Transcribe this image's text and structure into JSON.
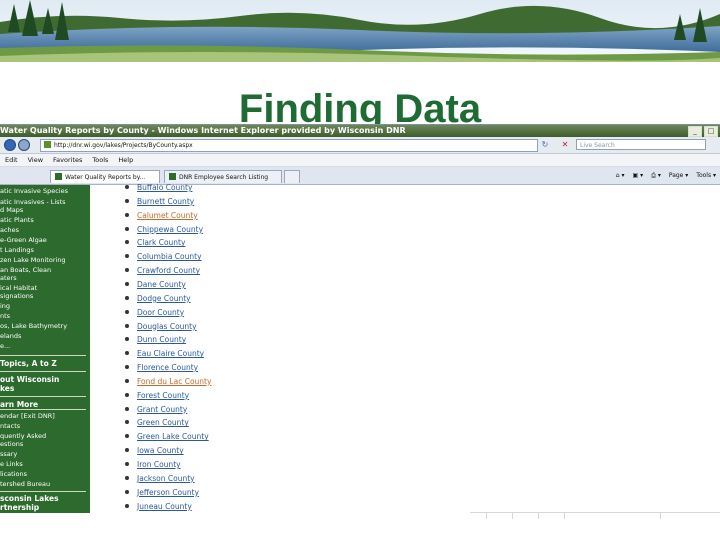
{
  "slide": {
    "title": "Finding Data"
  },
  "browser": {
    "window_title": "Water Quality Reports by County - Windows Internet Explorer provided by Wisconsin DNR",
    "address": "http://dnr.wi.gov/lakes/Projects/ByCounty.aspx",
    "search_placeholder": "Live Search",
    "menu": [
      "Edit",
      "View",
      "Favorites",
      "Tools",
      "Help"
    ],
    "tabs": [
      {
        "label": "Water Quality Reports by..."
      },
      {
        "label": "DNR Employee Search Listing"
      }
    ],
    "tools": {
      "page_label": "Page",
      "tools_label": "Tools"
    },
    "winbtns": {
      "minimize": "_",
      "maximize": "□"
    }
  },
  "sidebar": {
    "items": [
      "atic Invasive Species",
      "atic Invasives - Lists",
      "d Maps",
      "atic Plants",
      "aches",
      "e-Green Algae",
      "t Landings",
      "zen Lake Monitoring",
      "an Boats, Clean",
      "aters",
      "ical Habitat",
      "signations",
      "ing",
      "nts",
      "os, Lake Bathymetry",
      "elands",
      "e..."
    ],
    "head_topics": "Topics, A to Z",
    "head_about_1": "out Wisconsin",
    "head_about_2": "kes",
    "head_learn": "arn More",
    "learn_items": [
      "endar [Exit DNR]",
      "ntacts",
      "quently Asked",
      "estions",
      "ssary",
      "e Links",
      "lications",
      "tershed Bureau"
    ],
    "head_partner_1": "sconsin Lakes",
    "head_partner_2": "rtnership"
  },
  "counties": [
    {
      "name": "Buffalo County",
      "visited": false
    },
    {
      "name": "Burnett County",
      "visited": false
    },
    {
      "name": "Calumet County",
      "visited": true
    },
    {
      "name": "Chippewa County",
      "visited": false
    },
    {
      "name": "Clark County",
      "visited": false
    },
    {
      "name": "Columbia County",
      "visited": false
    },
    {
      "name": "Crawford County",
      "visited": false
    },
    {
      "name": "Dane County",
      "visited": false
    },
    {
      "name": "Dodge County",
      "visited": false
    },
    {
      "name": "Door County",
      "visited": false
    },
    {
      "name": "Douglas County",
      "visited": false
    },
    {
      "name": "Dunn County",
      "visited": false
    },
    {
      "name": "Eau Claire County",
      "visited": false
    },
    {
      "name": "Florence County",
      "visited": false
    },
    {
      "name": "Fond du Lac County",
      "visited": true
    },
    {
      "name": "Forest County",
      "visited": false
    },
    {
      "name": "Grant County",
      "visited": false
    },
    {
      "name": "Green County",
      "visited": false
    },
    {
      "name": "Green Lake County",
      "visited": false
    },
    {
      "name": "Iowa County",
      "visited": false
    },
    {
      "name": "Iron County",
      "visited": false
    },
    {
      "name": "Jackson County",
      "visited": false
    },
    {
      "name": "Jefferson County",
      "visited": false
    },
    {
      "name": "Juneau County",
      "visited": false
    }
  ],
  "colors": {
    "title_green": "#1f6b34",
    "sidebar_green": "#2d6a2e",
    "link_blue": "#2a5a9a",
    "link_visited": "#c26a2a"
  }
}
